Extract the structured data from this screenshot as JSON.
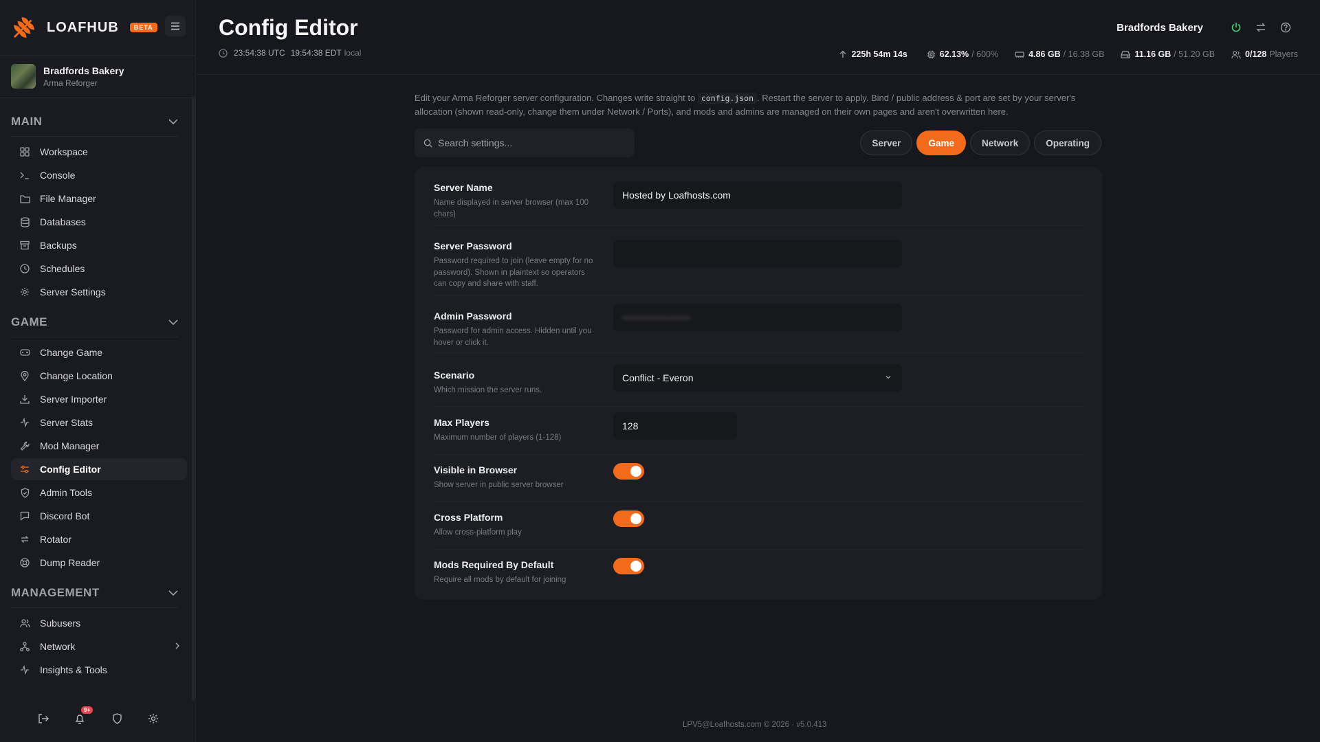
{
  "brand": {
    "name": "LOAFHUB",
    "badge": "BETA"
  },
  "server": {
    "name": "Bradfords Bakery",
    "game": "Arma Reforger"
  },
  "sidebar": {
    "sections": [
      {
        "title": "MAIN",
        "items": [
          {
            "label": "Workspace",
            "icon": "grid-icon"
          },
          {
            "label": "Console",
            "icon": "terminal-icon"
          },
          {
            "label": "File Manager",
            "icon": "folder-icon"
          },
          {
            "label": "Databases",
            "icon": "database-icon"
          },
          {
            "label": "Backups",
            "icon": "archive-icon"
          },
          {
            "label": "Schedules",
            "icon": "clock-icon"
          },
          {
            "label": "Server Settings",
            "icon": "gear-icon"
          }
        ]
      },
      {
        "title": "GAME",
        "items": [
          {
            "label": "Change Game",
            "icon": "gamepad-icon"
          },
          {
            "label": "Change Location",
            "icon": "map-pin-icon"
          },
          {
            "label": "Server Importer",
            "icon": "download-icon"
          },
          {
            "label": "Server Stats",
            "icon": "activity-icon"
          },
          {
            "label": "Mod Manager",
            "icon": "wrench-icon"
          },
          {
            "label": "Config Editor",
            "icon": "sliders-icon",
            "active": true
          },
          {
            "label": "Admin Tools",
            "icon": "shield-icon"
          },
          {
            "label": "Discord Bot",
            "icon": "chat-icon"
          },
          {
            "label": "Rotator",
            "icon": "repeat-icon"
          },
          {
            "label": "Dump Reader",
            "icon": "lifebuoy-icon"
          }
        ]
      },
      {
        "title": "MANAGEMENT",
        "items": [
          {
            "label": "Subusers",
            "icon": "users-icon"
          },
          {
            "label": "Network",
            "icon": "network-icon",
            "chevron": true
          },
          {
            "label": "Insights & Tools",
            "icon": "activity-icon"
          }
        ]
      }
    ],
    "notification_count": "9+"
  },
  "header": {
    "title": "Config Editor",
    "utc_time": "23:54:38 UTC",
    "local_time": "19:54:38 EDT",
    "local_label": "local",
    "server_name": "Bradfords Bakery",
    "stats": {
      "uptime": "225h 54m 14s",
      "cpu_value": "62.13%",
      "cpu_max": "/ 600%",
      "ram_value": "4.86 GB",
      "ram_max": "/ 16.38 GB",
      "disk_value": "11.16 GB",
      "disk_max": "/ 51.20 GB",
      "players_value": "0/128",
      "players_label": "Players"
    }
  },
  "intro": {
    "before": "Edit your Arma Reforger server configuration. Changes write straight to",
    "code": "config.json",
    "after": ". Restart the server to apply. Bind / public address & port are set by your server's allocation (shown read-only, change them under Network / Ports), and mods and admins are managed on their own pages and aren't overwritten here."
  },
  "search": {
    "placeholder": "Search settings..."
  },
  "tabs": [
    {
      "label": "Server"
    },
    {
      "label": "Game",
      "active": true
    },
    {
      "label": "Network"
    },
    {
      "label": "Operating"
    }
  ],
  "settings": {
    "server_name": {
      "label": "Server Name",
      "desc": "Name displayed in server browser (max 100 chars)",
      "value": "Hosted by Loafhosts.com"
    },
    "server_password": {
      "label": "Server Password",
      "desc": "Password required to join (leave empty for no password). Shown in plaintext so operators can copy and share with staff.",
      "value": ""
    },
    "admin_password": {
      "label": "Admin Password",
      "desc": "Password for admin access. Hidden until you hover or click it.",
      "value": "••••••••••••••••••"
    },
    "scenario": {
      "label": "Scenario",
      "desc": "Which mission the server runs.",
      "value": "Conflict - Everon"
    },
    "max_players": {
      "label": "Max Players",
      "desc": "Maximum number of players (1-128)",
      "value": "128"
    },
    "visible_in_browser": {
      "label": "Visible in Browser",
      "desc": "Show server in public server browser",
      "on": true
    },
    "cross_platform": {
      "label": "Cross Platform",
      "desc": "Allow cross-platform play",
      "on": true
    },
    "mods_required": {
      "label": "Mods Required By Default",
      "desc": "Require all mods by default for joining",
      "on": true
    }
  },
  "footer": {
    "text": "LPV5@Loafhosts.com © 2026 · v5.0.413"
  },
  "colors": {
    "accent": "#f26a1b",
    "background": "#17181d",
    "panel": "#1d1e23",
    "power_green": "#3ecf6a"
  }
}
